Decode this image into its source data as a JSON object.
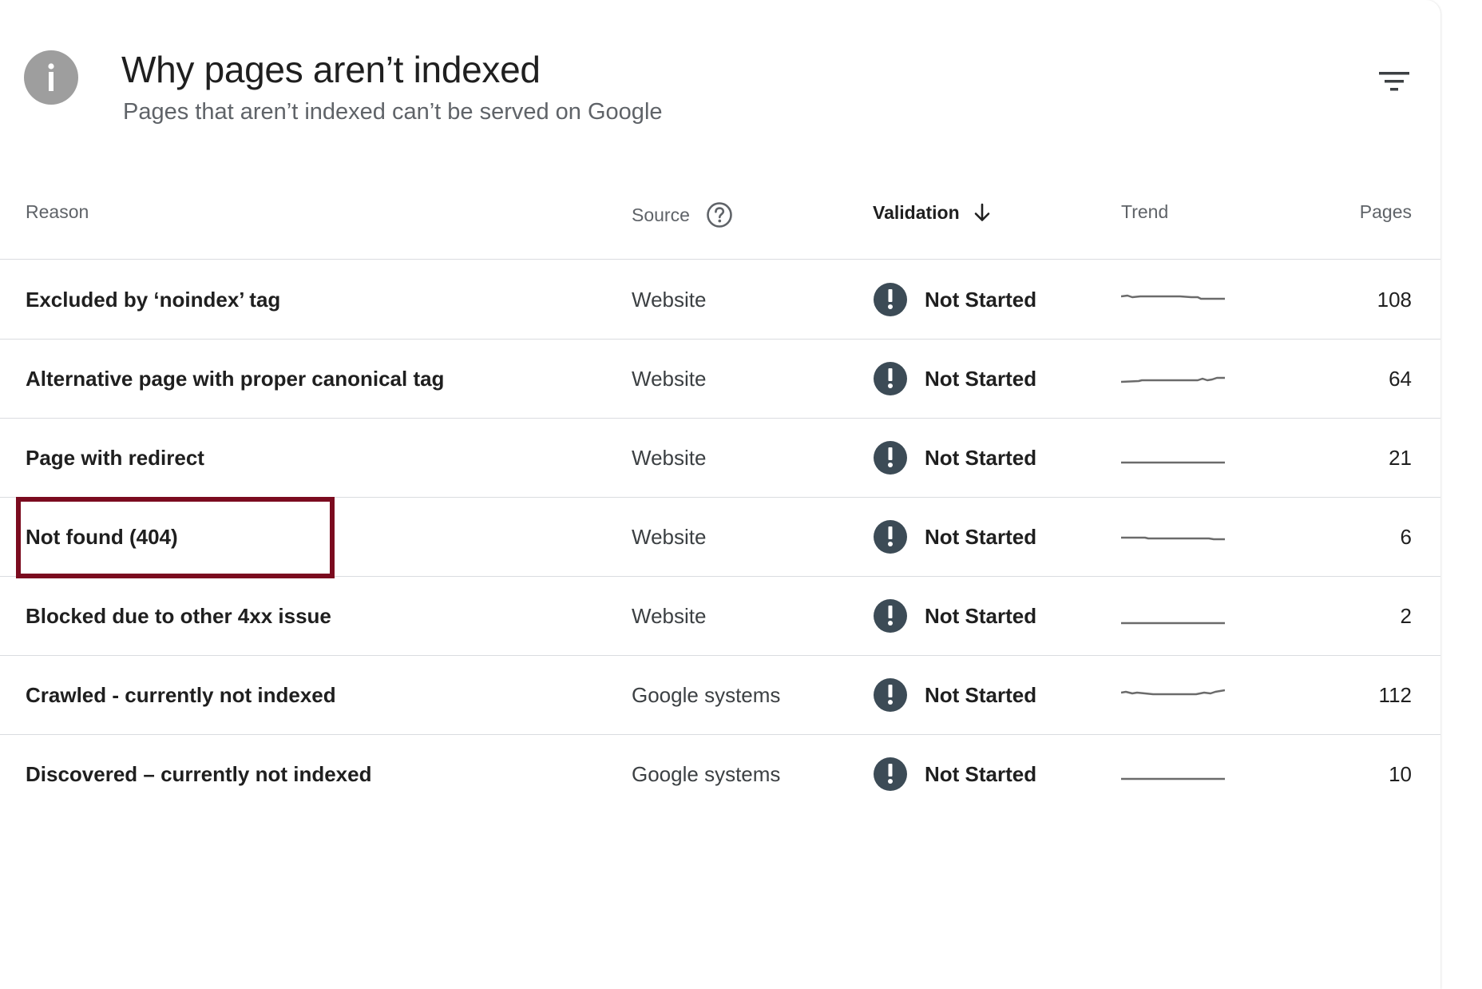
{
  "header": {
    "title": "Why pages aren’t indexed",
    "subtitle": "Pages that aren’t indexed can’t be served on Google",
    "info_icon": "info-icon",
    "filter_icon": "filter-icon"
  },
  "columns": {
    "reason": "Reason",
    "source": "Source",
    "validation": "Validation",
    "trend": "Trend",
    "pages": "Pages",
    "sorted_by": "validation",
    "sort_direction": "descending"
  },
  "rows": [
    {
      "reason": "Excluded by ‘noindex’ tag",
      "source": "Website",
      "validation": "Not Started",
      "pages": "108"
    },
    {
      "reason": "Alternative page with proper canonical tag",
      "source": "Website",
      "validation": "Not Started",
      "pages": "64"
    },
    {
      "reason": "Page with redirect",
      "source": "Website",
      "validation": "Not Started",
      "pages": "21"
    },
    {
      "reason": "Not found (404)",
      "source": "Website",
      "validation": "Not Started",
      "pages": "6"
    },
    {
      "reason": "Blocked due to other 4xx issue",
      "source": "Website",
      "validation": "Not Started",
      "pages": "2"
    },
    {
      "reason": "Crawled - currently not indexed",
      "source": "Google systems",
      "validation": "Not Started",
      "pages": "112"
    },
    {
      "reason": "Discovered – currently not indexed",
      "source": "Google systems",
      "validation": "Not Started",
      "pages": "10"
    }
  ],
  "highlighted_row": "Not found (404)",
  "colors": {
    "highlight_border": "#7b0b1f",
    "alert_icon": "#3c4b56",
    "info_icon": "#9e9e9e",
    "trend_line": "#6b6b6b"
  }
}
